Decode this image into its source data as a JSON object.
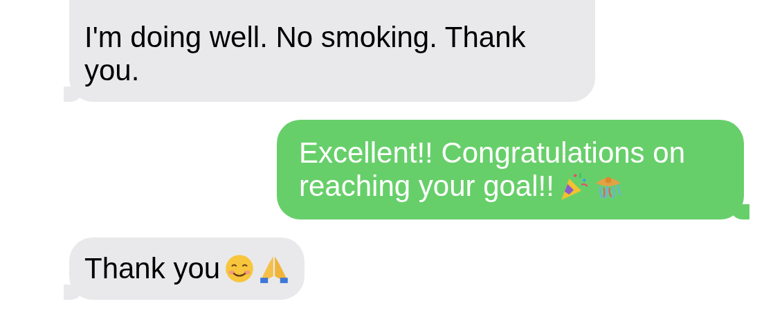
{
  "messages": [
    {
      "outgoing": false,
      "text": "I'm doing well. No smoking.  Thank you."
    },
    {
      "outgoing": true,
      "text": "Excellent!! Congratulations on reaching your goal!!",
      "icons": [
        {
          "kind": "party-popper"
        },
        {
          "kind": "confetti-ball"
        }
      ]
    },
    {
      "outgoing": false,
      "text": "Thank you",
      "icons": [
        {
          "kind": "smiling-face"
        },
        {
          "kind": "folded-hands"
        }
      ]
    }
  ]
}
